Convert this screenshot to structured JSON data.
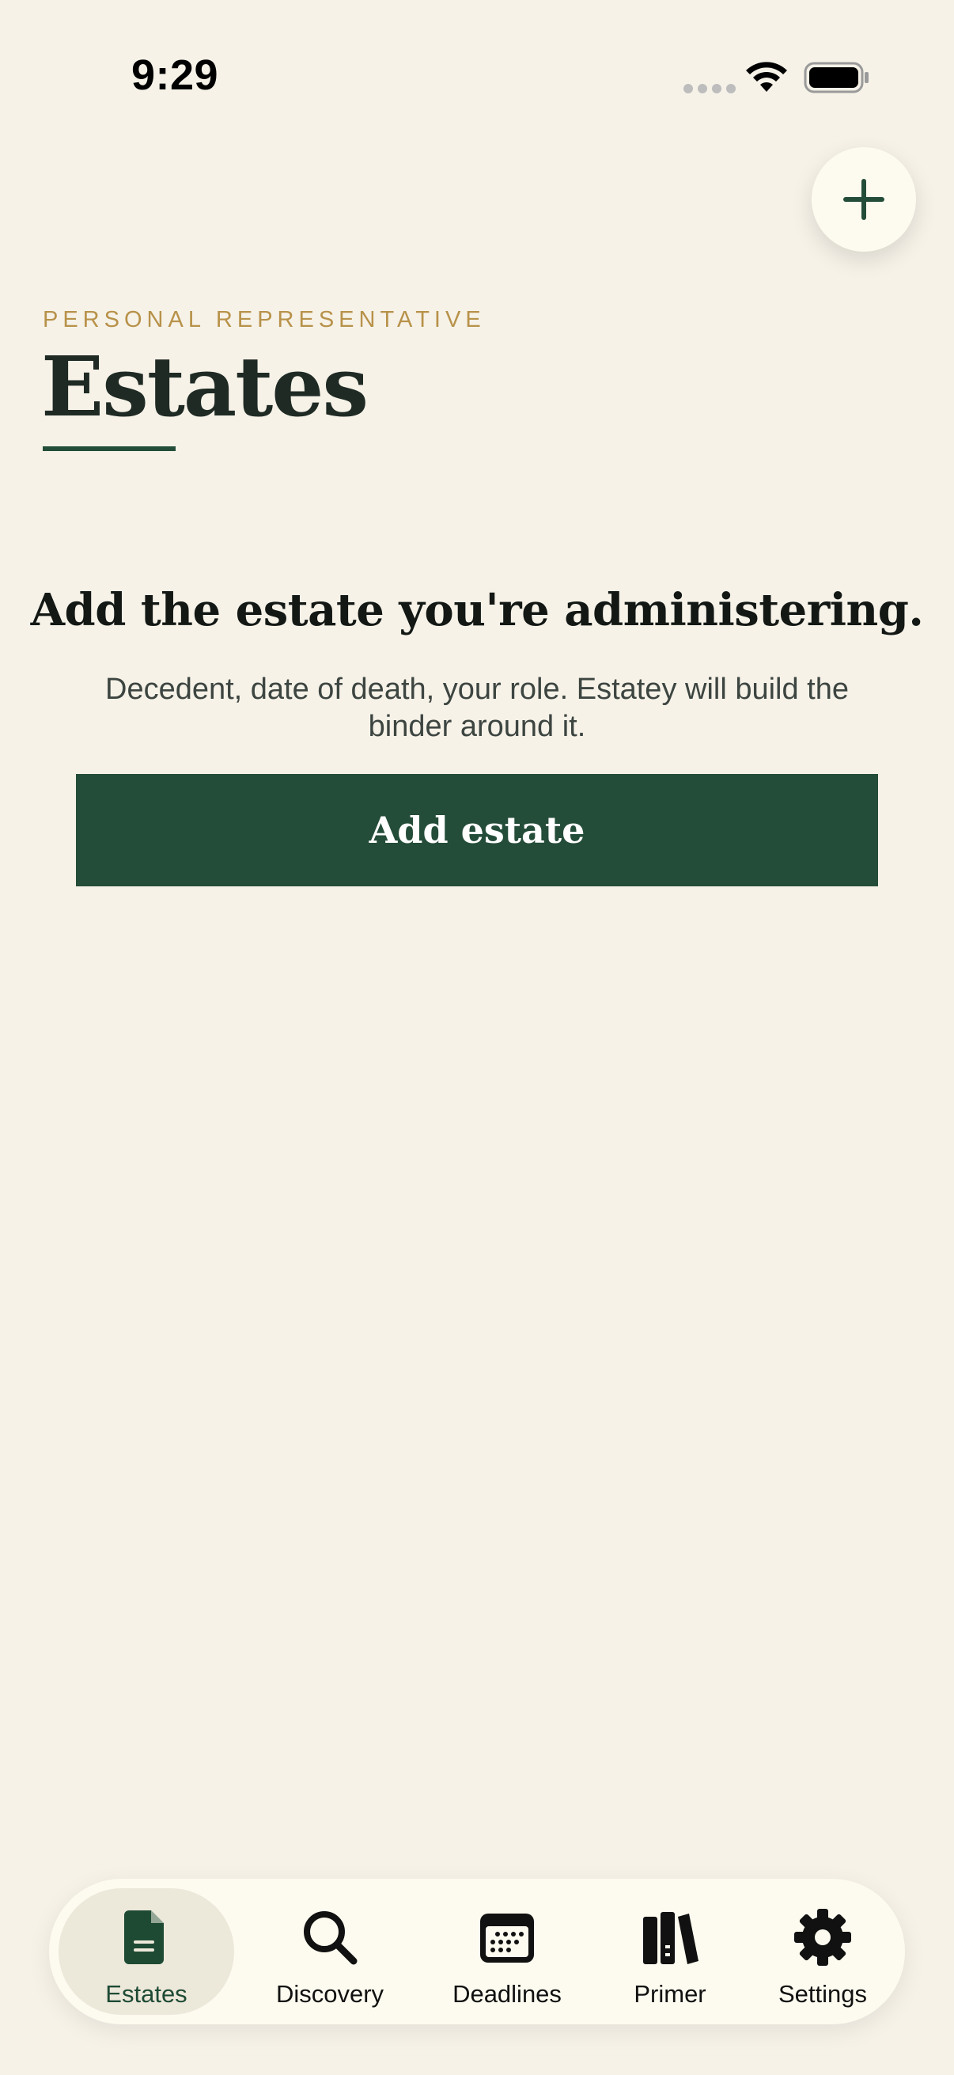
{
  "status_bar": {
    "time": "9:29"
  },
  "header": {
    "eyebrow": "PERSONAL REPRESENTATIVE",
    "title": "Estates",
    "add_button_icon": "plus-icon"
  },
  "empty_state": {
    "heading": "Add the estate you're administering.",
    "body": "Decedent, date of death, your role. Estatey will build the binder around it.",
    "button_label": "Add estate"
  },
  "tab_bar": {
    "tabs": [
      {
        "label": "Estates",
        "icon": "document-icon",
        "active": true
      },
      {
        "label": "Discovery",
        "icon": "search-icon",
        "active": false
      },
      {
        "label": "Deadlines",
        "icon": "calendar-icon",
        "active": false
      },
      {
        "label": "Primer",
        "icon": "books-icon",
        "active": false
      },
      {
        "label": "Settings",
        "icon": "gear-icon",
        "active": false
      }
    ]
  },
  "colors": {
    "background": "#f6f2e8",
    "accent": "#244d39",
    "eyebrow": "#b8924a",
    "surface": "#fdfbef"
  }
}
